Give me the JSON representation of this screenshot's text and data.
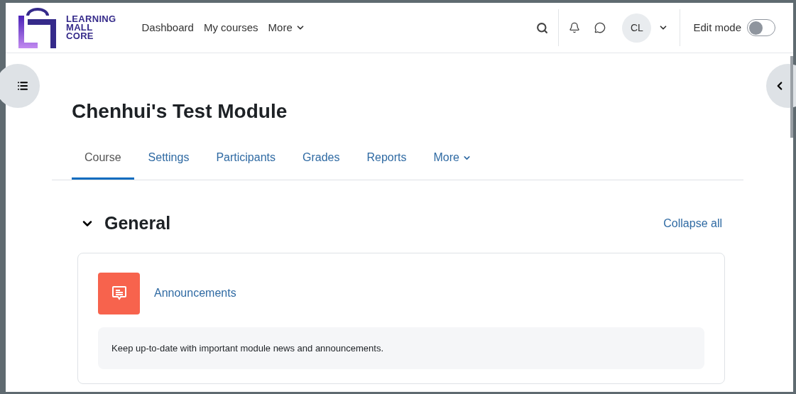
{
  "logo": {
    "lines": [
      "LEARNING",
      "MALL",
      "CORE"
    ]
  },
  "nav": {
    "items": [
      {
        "label": "Dashboard",
        "dropdown": false
      },
      {
        "label": "My courses",
        "dropdown": false
      },
      {
        "label": "More",
        "dropdown": true
      }
    ]
  },
  "user": {
    "initials": "CL"
  },
  "edit_mode": {
    "label": "Edit mode",
    "on": false
  },
  "course": {
    "title": "Chenhui's Test Module"
  },
  "tabs": [
    {
      "label": "Course",
      "selected": true,
      "dropdown": false
    },
    {
      "label": "Settings",
      "selected": false,
      "dropdown": false
    },
    {
      "label": "Participants",
      "selected": false,
      "dropdown": false
    },
    {
      "label": "Grades",
      "selected": false,
      "dropdown": false
    },
    {
      "label": "Reports",
      "selected": false,
      "dropdown": false
    },
    {
      "label": "More",
      "selected": false,
      "dropdown": true
    }
  ],
  "section": {
    "title": "General",
    "expanded": true,
    "collapse_label": "Collapse all",
    "activities": [
      {
        "name": "Announcements",
        "description": "Keep up-to-date with important module news and announcements."
      }
    ]
  }
}
